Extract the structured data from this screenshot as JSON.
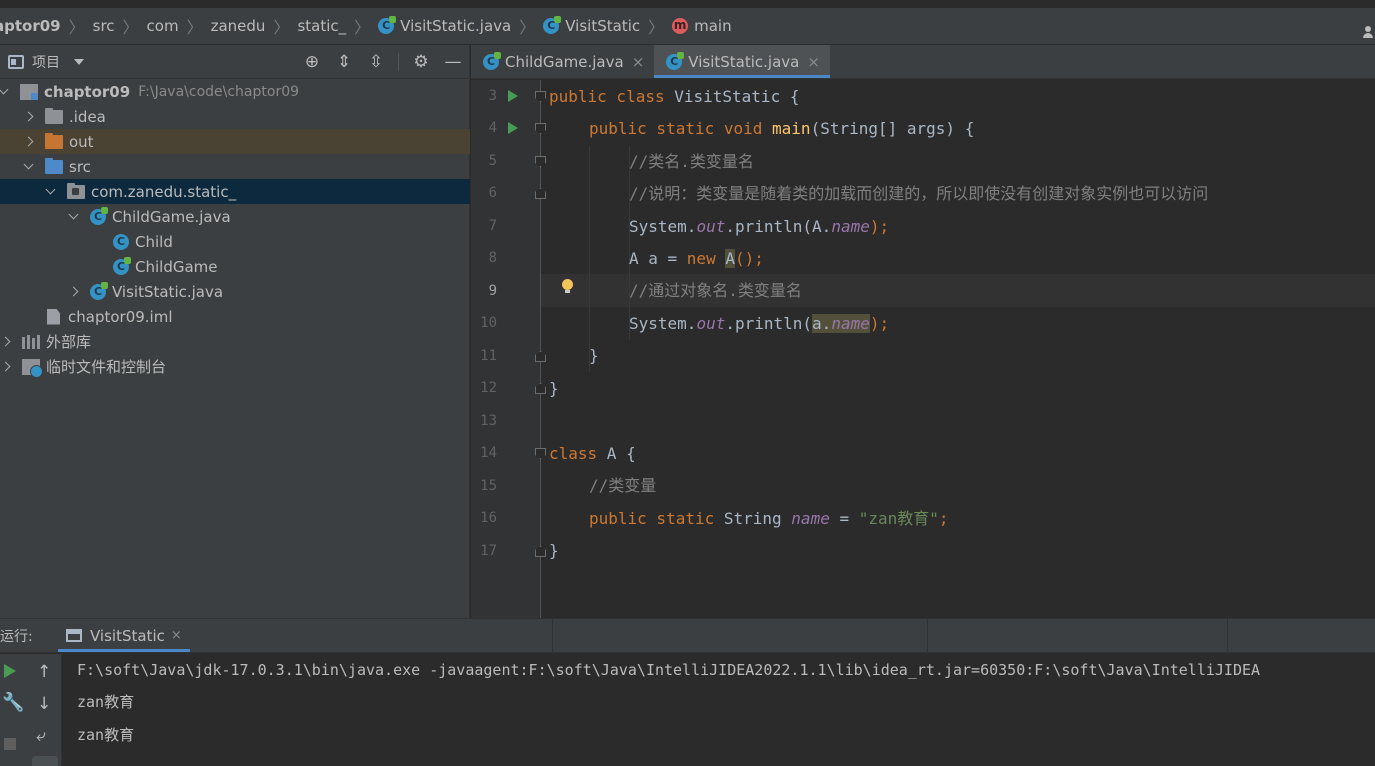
{
  "breadcrumb": {
    "items": [
      "aptor09",
      "src",
      "com",
      "zanedu",
      "static_",
      "VisitStatic.java",
      "VisitStatic",
      "main"
    ]
  },
  "project_panel": {
    "title": "项目",
    "tree": [
      {
        "label": "chaptor09",
        "path": "F:\\Java\\code\\chaptor09"
      },
      {
        "label": ".idea"
      },
      {
        "label": "out"
      },
      {
        "label": "src"
      },
      {
        "label": "com.zanedu.static_"
      },
      {
        "label": "ChildGame.java"
      },
      {
        "label": "Child"
      },
      {
        "label": "ChildGame"
      },
      {
        "label": "VisitStatic.java"
      },
      {
        "label": "chaptor09.iml"
      },
      {
        "label": "外部库"
      },
      {
        "label": "临时文件和控制台"
      }
    ]
  },
  "editor": {
    "tabs": [
      {
        "label": "ChildGame.java",
        "close": "×"
      },
      {
        "label": "VisitStatic.java",
        "close": "×"
      }
    ],
    "line_numbers": [
      "3",
      "4",
      "5",
      "6",
      "7",
      "8",
      "9",
      "10",
      "11",
      "12",
      "13",
      "14",
      "15",
      "16",
      "17"
    ],
    "code": {
      "l3": {
        "t1": "public class ",
        "t2": "VisitStatic {"
      },
      "l4": {
        "t1": "public static void ",
        "t2": "main",
        "t3": "(String[] args) {"
      },
      "l5": {
        "t1": "//类名.类变量名"
      },
      "l6": {
        "t1": "//说明：类变量是随着类的加载而创建的，所以即使没有创建对象实例也可以访问"
      },
      "l7": {
        "t1": "System.",
        "t2": "out",
        "t3": ".println(A.",
        "t4": "name",
        "t5": ");"
      },
      "l8": {
        "t1": "A a = ",
        "t2": "new ",
        "t3": "A",
        "t4": "();"
      },
      "l9": {
        "t1": "//通过对象名.类变量名"
      },
      "l10": {
        "t1": "System.",
        "t2": "out",
        "t3": ".println(",
        "t4": "a.",
        "t5": "name",
        "t6": ");"
      },
      "l11": {
        "t1": "}"
      },
      "l12": {
        "t1": "}"
      },
      "l14": {
        "t1": "class ",
        "t2": "A {"
      },
      "l15": {
        "t1": "//类变量"
      },
      "l16": {
        "t1": "public static ",
        "t2": "String ",
        "t3": "name",
        "t4": " = ",
        "t5": "\"zan教育\"",
        "t6": ";"
      },
      "l17": {
        "t1": "}"
      }
    }
  },
  "run_panel": {
    "label": "运行:",
    "tab": "VisitStatic",
    "tab_close": "×",
    "output": [
      "F:\\soft\\Java\\jdk-17.0.3.1\\bin\\java.exe -javaagent:F:\\soft\\Java\\IntelliJIDEA2022.1.1\\lib\\idea_rt.jar=60350:F:\\soft\\Java\\IntelliJIDEA",
      "zan教育",
      "zan教育"
    ]
  },
  "colors": {
    "keyword": "#cc7832",
    "function": "#ffc66d",
    "comment": "#808080",
    "field": "#9876aa",
    "string": "#6a8759",
    "selection": "#0d293e",
    "accent": "#4a88c7"
  }
}
